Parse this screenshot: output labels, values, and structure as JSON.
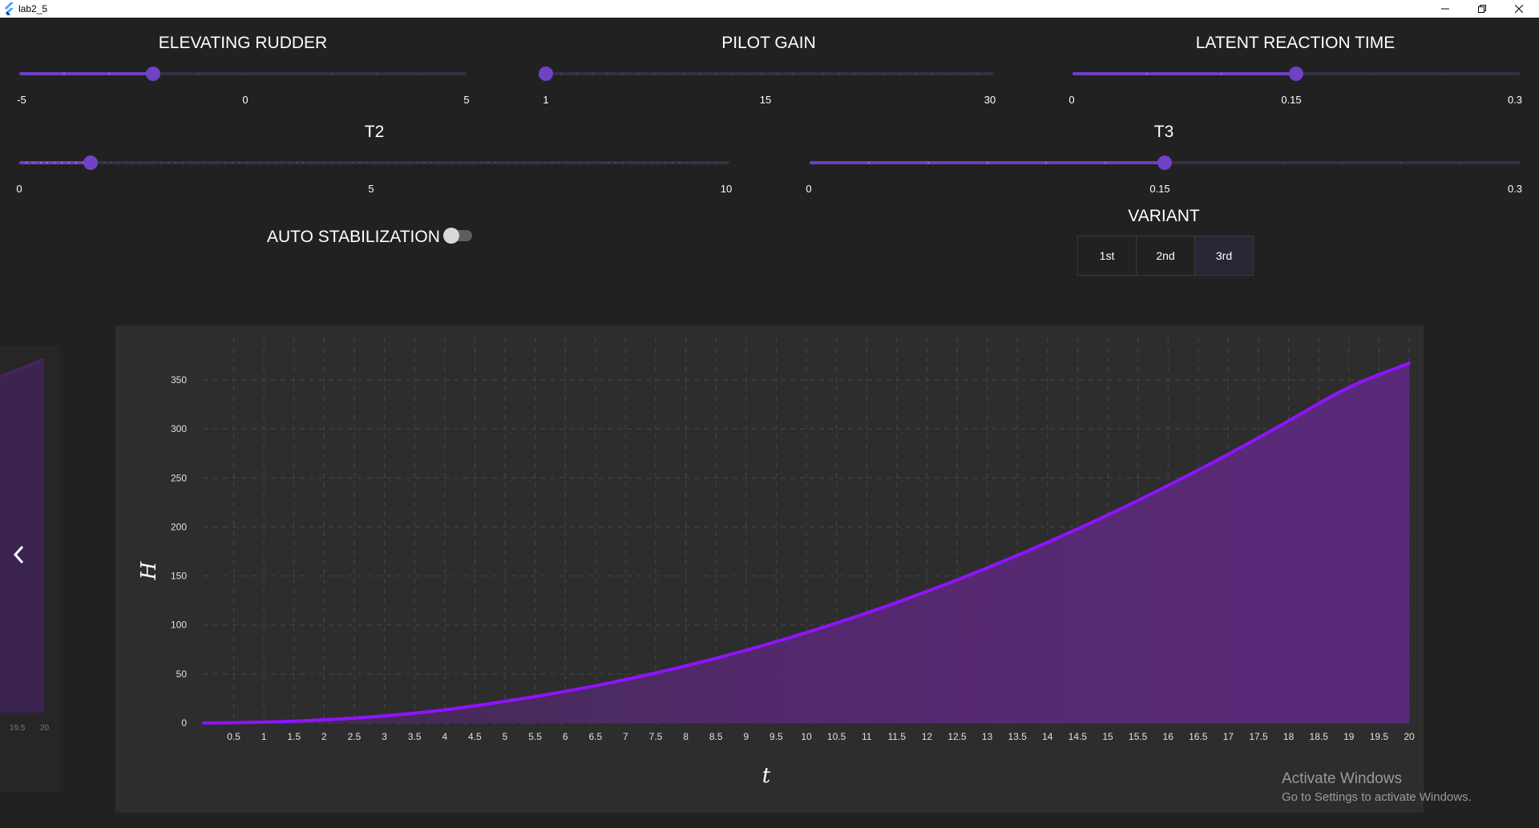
{
  "window": {
    "title": "lab2_5"
  },
  "sliders": {
    "elevating_rudder": {
      "label": "ELEVATING RUDDER",
      "min_label": "-5",
      "mid_label": "0",
      "max_label": "5",
      "min": -5,
      "max": 5,
      "value": -2,
      "divisions": 10
    },
    "pilot_gain": {
      "label": "PILOT GAIN",
      "min_label": "1",
      "mid_label": "15",
      "max_label": "30",
      "min": 1,
      "max": 30,
      "value": 1,
      "divisions": 29
    },
    "latent_reaction_time": {
      "label": "LATENT REACTION TIME",
      "min_label": "0",
      "mid_label": "0.15",
      "max_label": "0.3",
      "min": 0,
      "max": 0.3,
      "value": 0.15,
      "divisions": 6
    },
    "t2": {
      "label": "T2",
      "min_label": "0",
      "mid_label": "5",
      "max_label": "10",
      "min": 0,
      "max": 10,
      "value": 1,
      "divisions": 100
    },
    "t3": {
      "label": "T3",
      "min_label": "0",
      "mid_label": "0.15",
      "max_label": "0.3",
      "min": 0,
      "max": 0.3,
      "value": 0.15,
      "divisions": 12
    }
  },
  "auto_stabilization": {
    "label": "AUTO STABILIZATION",
    "enabled": false
  },
  "variant": {
    "label": "VARIANT",
    "options": [
      "1st",
      "2nd",
      "3rd"
    ],
    "selected": "3rd"
  },
  "carousel": {
    "prev_icon": "chevron-left-icon",
    "side_labels": [
      "19.5",
      "20"
    ]
  },
  "chart_data": {
    "type": "area",
    "xlabel": "t",
    "ylabel": "H",
    "x_ticks": [
      "0.5",
      "1",
      "1.5",
      "2",
      "2.5",
      "3",
      "3.5",
      "4",
      "4.5",
      "5",
      "5.5",
      "6",
      "6.5",
      "7",
      "7.5",
      "8",
      "8.5",
      "9",
      "9.5",
      "10",
      "10.5",
      "11",
      "11.5",
      "12",
      "12.5",
      "13",
      "13.5",
      "14",
      "14.5",
      "15",
      "15.5",
      "16",
      "16.5",
      "17",
      "17.5",
      "18",
      "18.5",
      "19",
      "19.5",
      "20"
    ],
    "y_ticks": [
      "0",
      "50",
      "100",
      "150",
      "200",
      "250",
      "300",
      "350"
    ],
    "xlim": [
      0,
      20
    ],
    "ylim": [
      0,
      350
    ],
    "grid": true,
    "x": [
      0,
      1,
      2,
      3,
      4,
      5,
      6,
      7,
      8,
      9,
      10,
      11,
      12,
      13,
      14,
      15,
      16,
      17,
      18,
      19,
      20
    ],
    "y": [
      0,
      0.7,
      3,
      7,
      13,
      22,
      32,
      44,
      58,
      74,
      92,
      112,
      134,
      158,
      184,
      212,
      242,
      274,
      308,
      344,
      367
    ],
    "color": "#9013fe",
    "fill_color": "#54296e"
  },
  "watermark": {
    "line1": "Activate Windows",
    "line2": "Go to Settings to activate Windows."
  },
  "colors": {
    "accent": "#6f42c6",
    "track": "#353044",
    "background": "#212121",
    "chart_bg": "#2d2d2d"
  }
}
